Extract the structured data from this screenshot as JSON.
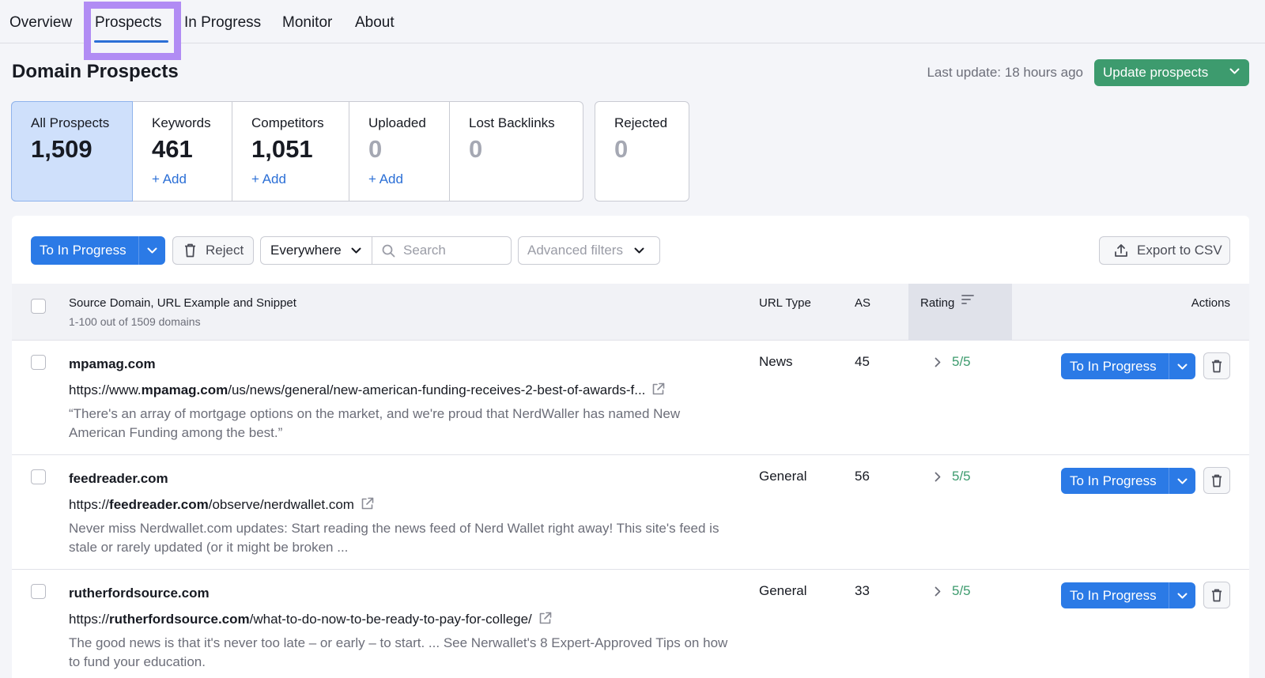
{
  "nav": {
    "tabs": [
      {
        "label": "Overview"
      },
      {
        "label": "Prospects"
      },
      {
        "label": "In Progress"
      },
      {
        "label": "Monitor"
      },
      {
        "label": "About"
      }
    ],
    "active_tab": "Prospects"
  },
  "header": {
    "title": "Domain Prospects",
    "last_update": "Last update: 18 hours ago",
    "update_button": "Update prospects"
  },
  "cards": [
    {
      "label": "All Prospects",
      "value": "1,509"
    },
    {
      "label": "Keywords",
      "value": "461",
      "add": "+ Add"
    },
    {
      "label": "Competitors",
      "value": "1,051",
      "add": "+ Add"
    },
    {
      "label": "Uploaded",
      "value": "0",
      "add": "+ Add"
    },
    {
      "label": "Lost Backlinks",
      "value": "0"
    },
    {
      "label": "Rejected",
      "value": "0"
    }
  ],
  "toolbar": {
    "to_in_progress": "To In Progress",
    "reject": "Reject",
    "scope": "Everywhere",
    "search_placeholder": "Search",
    "advanced_filters": "Advanced filters",
    "export": "Export to CSV"
  },
  "table": {
    "col_source": "Source Domain, URL Example and Snippet",
    "col_source_sub": "1-100 out of 1509 domains",
    "col_url_type": "URL Type",
    "col_as": "AS",
    "col_rating": "Rating",
    "col_actions": "Actions",
    "rows": [
      {
        "domain": "mpamag.com",
        "url_prefix": "https://www.",
        "url_domain": "mpamag.com",
        "url_path": "/us/news/general/new-american-funding-receives-2-best-of-awards-f...",
        "snippet": "“There's an array of mortgage options on the market, and we're proud that NerdWaller has named New American Funding among the best.”",
        "url_type": "News",
        "as": "45",
        "rating": "5/5",
        "action": "To In Progress"
      },
      {
        "domain": "feedreader.com",
        "url_prefix": "https://",
        "url_domain": "feedreader.com",
        "url_path": "/observe/nerdwallet.com",
        "snippet": "Never miss Nerdwallet.com updates: Start reading the news feed of Nerd Wallet right away! This site's feed is stale or rarely updated (or it might be broken ...",
        "url_type": "General",
        "as": "56",
        "rating": "5/5",
        "action": "To In Progress"
      },
      {
        "domain": "rutherfordsource.com",
        "url_prefix": "https://",
        "url_domain": "rutherfordsource.com",
        "url_path": "/what-to-do-now-to-be-ready-to-pay-for-college/",
        "snippet": "The good news is that it's never too late – or early – to start. ... See Nerwallet's 8 Expert-Approved Tips on how to fund your education.",
        "url_type": "General",
        "as": "33",
        "rating": "5/5",
        "action": "To In Progress"
      }
    ]
  },
  "colors": {
    "primary_blue": "#2b7ae6",
    "green": "#3d9b6e",
    "highlight_purple": "#b18cf4",
    "active_card": "#cfe0fb"
  }
}
